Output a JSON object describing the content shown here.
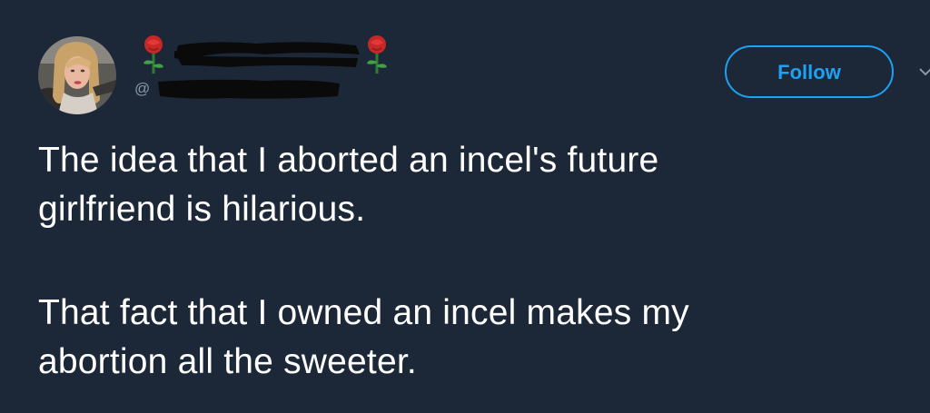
{
  "tweet": {
    "author": {
      "handle_prefix": "@",
      "name_emoji_left": "rose-emoji",
      "name_emoji_right": "rose-emoji",
      "name_redacted": true,
      "handle_redacted": true
    },
    "follow_label": "Follow",
    "text": {
      "line1": "The idea that I aborted an incel's future",
      "line2": "girlfriend is hilarious.",
      "line3": "That fact that I owned an incel makes my",
      "line4": "abortion all the sweeter."
    }
  },
  "colors": {
    "background": "#1c2838",
    "accent": "#1da1f2",
    "secondary_text": "#8899a6",
    "primary_text": "#ffffff"
  }
}
